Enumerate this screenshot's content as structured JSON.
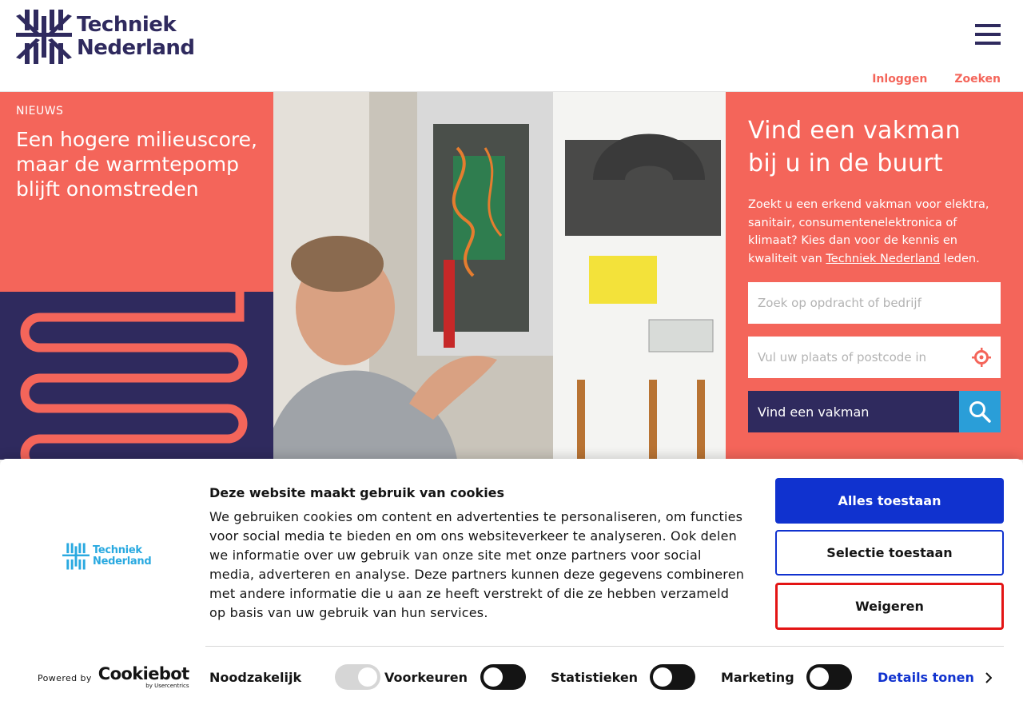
{
  "header": {
    "logo_line1": "Techniek",
    "logo_line2": "Nederland",
    "links": {
      "login": "Inloggen",
      "search": "Zoeken"
    }
  },
  "news": {
    "kicker": "NIEUWS",
    "title": "Een hogere milieuscore, maar de warmtepomp blijft onomstreden"
  },
  "finder": {
    "title_line1": "Vind een vakman",
    "title_line2": "bij u in de buurt",
    "text_before_link": "Zoekt u een erkend vakman voor elektra, sanitair, consumentenelektronica of klimaat? Kies dan voor de kennis en kwaliteit van ",
    "link_text": "Techniek Nederland",
    "text_after_link": " leden.",
    "search_placeholder": "Zoek op opdracht of bedrijf",
    "location_placeholder": "Vul uw plaats of postcode in",
    "button_label": "Vind een vakman"
  },
  "cookie": {
    "logo_line1": "Techniek",
    "logo_line2": "Nederland",
    "title": "Deze website maakt gebruik van cookies",
    "body": "We gebruiken cookies om content en advertenties te personaliseren, om functies voor social media te bieden en om ons websiteverkeer te analyseren. Ook delen we informatie over uw gebruik van onze site met onze partners voor social media, adverteren en analyse. Deze partners kunnen deze gegevens combineren met andere informatie die u aan ze heeft verstrekt of die ze hebben verzameld op basis van uw gebruik van hun services.",
    "buttons": {
      "allow_all": "Alles toestaan",
      "allow_selection": "Selectie toestaan",
      "deny": "Weigeren"
    },
    "powered_by": "Powered by",
    "brand": "Cookiebot",
    "brand_sub": "by Usercentrics",
    "toggles": [
      {
        "label": "Noodzakelijk",
        "state": "disabled-on"
      },
      {
        "label": "Voorkeuren",
        "state": "off"
      },
      {
        "label": "Statistieken",
        "state": "off"
      },
      {
        "label": "Marketing",
        "state": "off"
      }
    ],
    "details_label": "Details tonen"
  },
  "colors": {
    "brand_navy": "#2f2a5e",
    "brand_coral": "#f4655a",
    "accent_blue": "#2a9ed8",
    "cookie_blue": "#1032cf",
    "deny_outline": "#e31414"
  }
}
